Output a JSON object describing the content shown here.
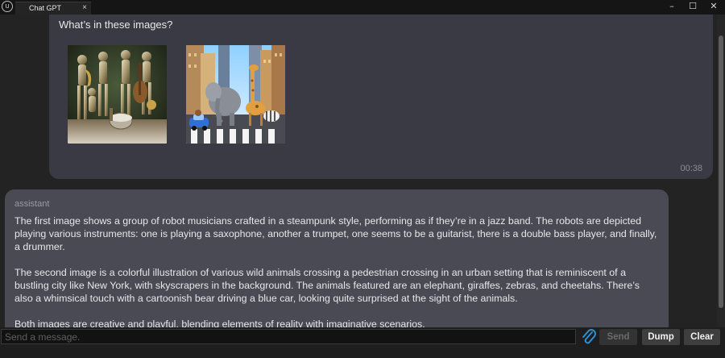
{
  "window": {
    "app_icon": "unreal-engine-logo",
    "app_icon_text": "U",
    "tab_title": "Chat GPT",
    "tab_close": "×",
    "minimize": "–",
    "maximize": "☐",
    "close": "✕"
  },
  "chat": {
    "user_message": {
      "text": "What’s in these images?",
      "time": "00:38",
      "images": [
        "robot-jazz-band-image",
        "animals-crossing-street-image"
      ]
    },
    "assistant_message": {
      "role": "assistant",
      "paragraphs": [
        "The first image shows a group of robot musicians crafted in a steampunk style, performing as if they’re in a jazz band. The robots are depicted playing various instruments: one is playing a saxophone, another a trumpet, one seems to be a guitarist, there is a double bass player, and finally, a drummer.",
        "The second image is a colorful illustration of various wild animals crossing a pedestrian crossing in an urban setting that is reminiscent of a bustling city like New York, with skyscrapers in the background. The animals featured are an elephant, giraffes, zebras, and cheetahs. There’s also a whimsical touch with a cartoonish bear driving a blue car, looking quite surprised at the sight of the animals.",
        "Both images are creative and playful, blending elements of reality with imaginative scenarios."
      ]
    }
  },
  "input_bar": {
    "placeholder": "Send a message.",
    "value": "",
    "attach_icon": "paperclip-icon",
    "send_label": "Send",
    "dump_label": "Dump",
    "clear_label": "Clear"
  },
  "colors": {
    "user_bubble": "#3a3a44",
    "assistant_bubble": "#4a4a55",
    "background": "#232323",
    "attach_icon": "#2e8fd6"
  }
}
